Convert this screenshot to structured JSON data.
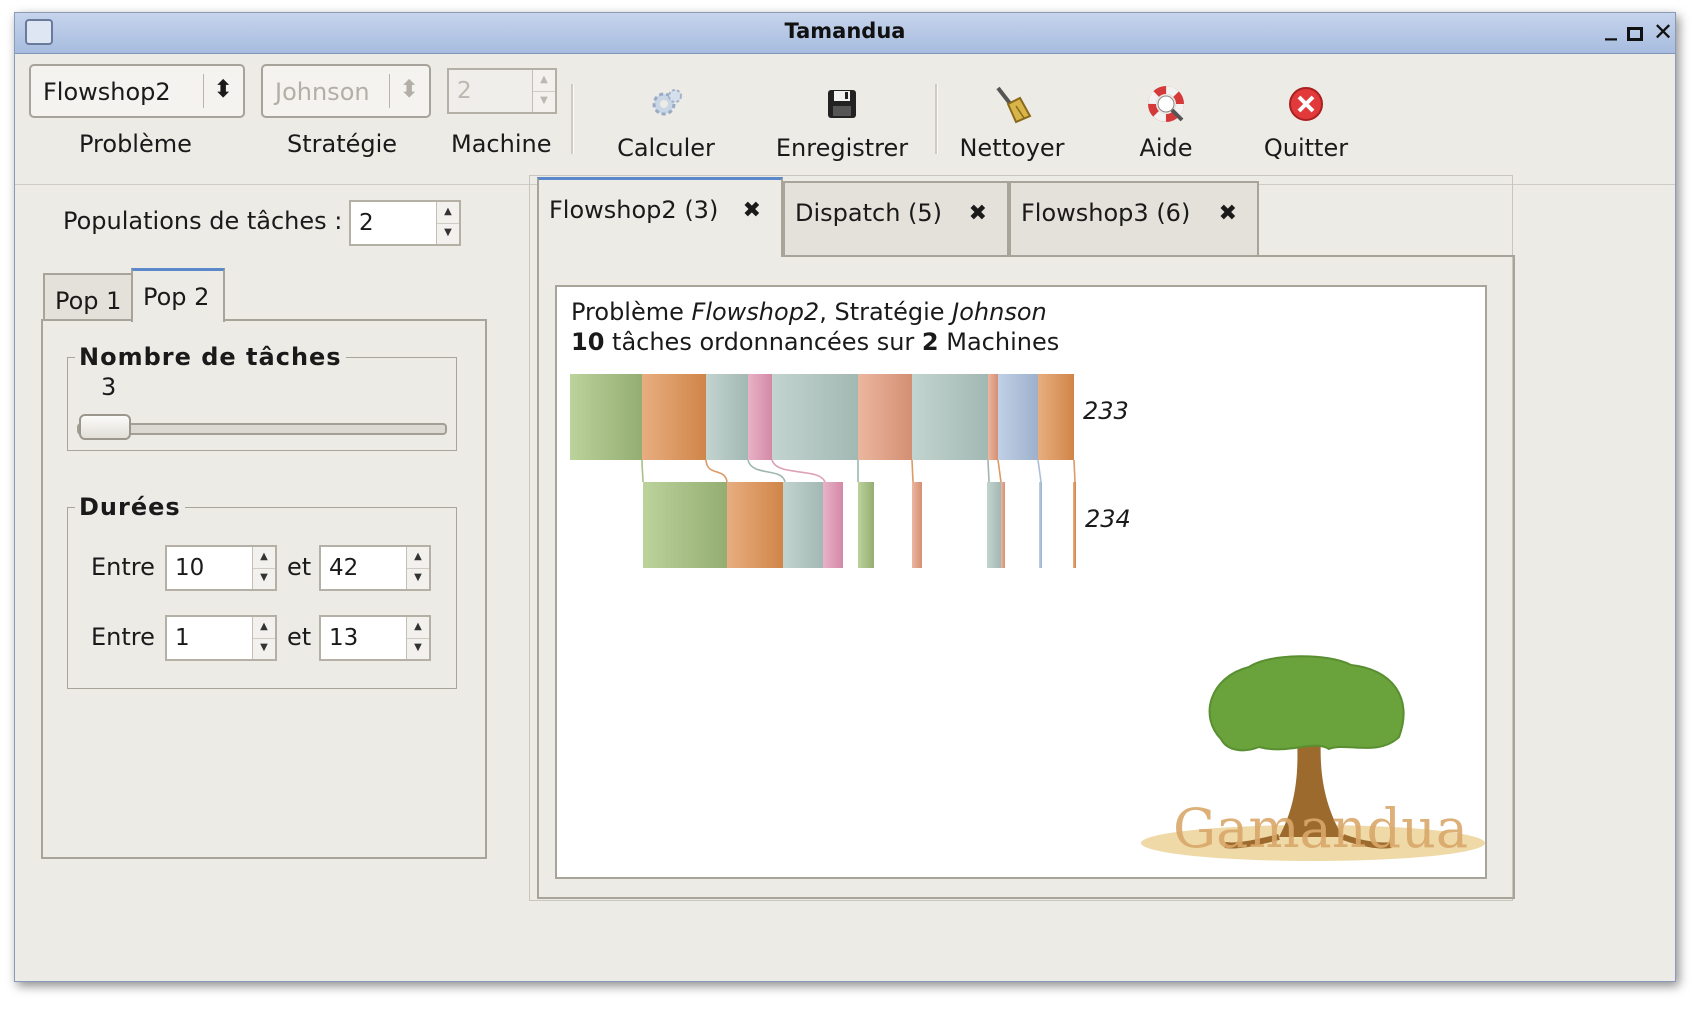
{
  "window": {
    "title": "Tamandua"
  },
  "toolbar": {
    "problem": {
      "value": "Flowshop2",
      "label": "Problème"
    },
    "strategy": {
      "value": "Johnson",
      "label": "Stratégie"
    },
    "machine": {
      "value": "2",
      "label": "Machine"
    },
    "buttons": [
      {
        "label": "Calculer",
        "icon": "gear-icon"
      },
      {
        "label": "Enregistrer",
        "icon": "floppy-icon"
      },
      {
        "label": "Nettoyer",
        "icon": "broom-icon"
      },
      {
        "label": "Aide",
        "icon": "lifebuoy-icon"
      },
      {
        "label": "Quitter",
        "icon": "close-circle-icon"
      }
    ]
  },
  "left": {
    "populations_label": "Populations de tâches :",
    "populations_value": "2",
    "tabs": [
      {
        "label": "Pop 1"
      },
      {
        "label": "Pop 2",
        "active": true
      }
    ],
    "nb_taches": {
      "title": "Nombre de tâches",
      "value": "3",
      "level": 3
    },
    "durees": {
      "title": "Durées",
      "rows": [
        {
          "entre": "Entre",
          "min": "10",
          "et": "et",
          "max": "42"
        },
        {
          "entre": "Entre",
          "min": "1",
          "et": "et",
          "max": "13"
        }
      ]
    }
  },
  "right": {
    "tabs": [
      {
        "label": "Flowshop2 (3)",
        "active": true
      },
      {
        "label": "Dispatch (5)"
      },
      {
        "label": "Flowshop3 (6)"
      }
    ],
    "caption": {
      "line1_a": "Problème ",
      "line1_problem": "Flowshop2",
      "line1_b": ", Stratégie ",
      "line1_strategy": "Johnson",
      "line2_count": "10",
      "line2_a": " tâches ordonnancées sur ",
      "line2_machines": "2",
      "line2_b": " Machines"
    },
    "gantt": {
      "rows": [
        {
          "label": "233"
        },
        {
          "label": "234"
        }
      ],
      "colors": {
        "green": "#a9c089",
        "orange": "#dc9a66",
        "grey": "#b2c6c1",
        "pink": "#dca1b8",
        "salmon": "#e1a58c",
        "blue": "#adbfd8"
      }
    },
    "logo_text": "Gamandua"
  }
}
